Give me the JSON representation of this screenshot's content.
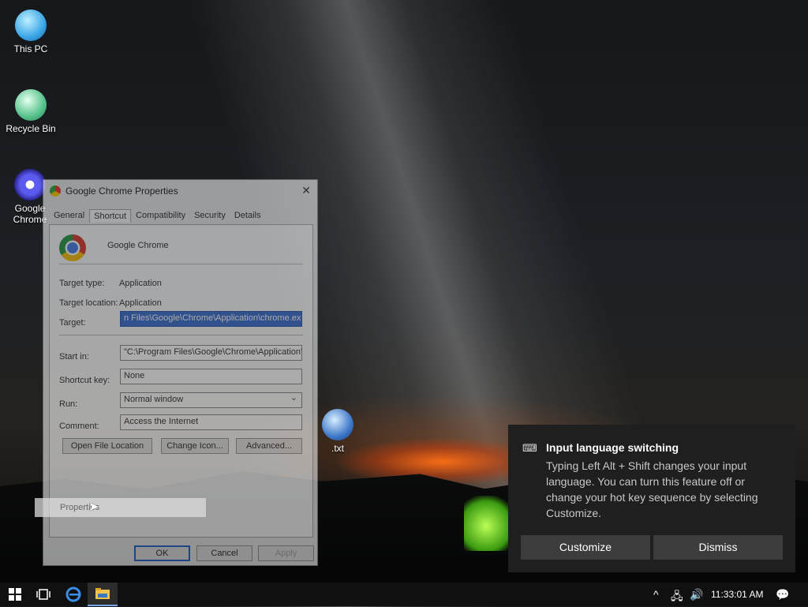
{
  "desktop": {
    "icons": [
      {
        "label": "This PC"
      },
      {
        "label": "Recycle Bin"
      },
      {
        "label": "Google Chrome"
      },
      {
        "label": ".txt"
      }
    ]
  },
  "dialog": {
    "title": "Google Chrome Properties",
    "close_glyph": "✕",
    "tabs": [
      "General",
      "Shortcut",
      "Compatibility",
      "Security",
      "Details"
    ],
    "active_tab": "Shortcut",
    "app_name": "Google Chrome",
    "target_type_label": "Target type:",
    "target_type_value": "Application",
    "target_location_label": "Target location:",
    "target_location_value": "Application",
    "target_label": "Target:",
    "target_value": "n Files\\Google\\Chrome\\Application\\chrome.exe\"",
    "start_in_label": "Start in:",
    "start_in_value": "\"C:\\Program Files\\Google\\Chrome\\Application\"",
    "shortcut_key_label": "Shortcut key:",
    "shortcut_key_value": "None",
    "run_label": "Run:",
    "run_value": "Normal window",
    "comment_label": "Comment:",
    "comment_value": "Access the Internet",
    "open_file_location": "Open File Location",
    "change_icon": "Change Icon...",
    "advanced": "Advanced...",
    "ok": "OK",
    "cancel": "Cancel",
    "apply": "Apply"
  },
  "context_item": {
    "label": "Properties"
  },
  "toast": {
    "icon": "⌨",
    "title": "Input language switching",
    "body": "Typing Left Alt + Shift changes your input language. You can turn this feature off or change your hot key sequence by selecting Customize.",
    "customize": "Customize",
    "dismiss": "Dismiss"
  },
  "taskbar": {
    "start_icon": "windows-logo",
    "task_view_icon": "task-view",
    "edge_icon": "edge",
    "explorer_icon": "file-explorer",
    "tray_chevron": "^",
    "network_glyph": "🖧",
    "volume_glyph": "🔊",
    "clock": "11:33:01 AM",
    "notification_glyph": "💬"
  }
}
